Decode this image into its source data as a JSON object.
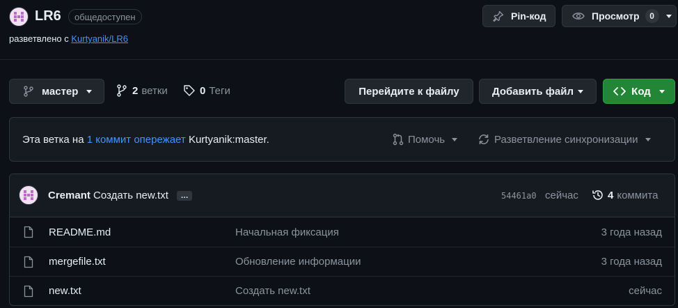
{
  "repo": {
    "name": "LR6",
    "visibility": "общедоступен",
    "forked_prefix": "разветвлено с",
    "forked_from": "Kurtyanik/LR6"
  },
  "actions": {
    "pin_label": "Pin-код",
    "watch_label": "Просмотр",
    "watch_count": "0"
  },
  "branch_bar": {
    "branch": "мастер",
    "branches_count": "2",
    "branches_label": "ветки",
    "tags_count": "0",
    "tags_label": "Теги",
    "goto_file": "Перейдите к файлу",
    "add_file": "Добавить файл",
    "code": "Код"
  },
  "ahead": {
    "prefix": "Эта ветка на",
    "link": "1 коммит опережает",
    "suffix": "Kurtyanik:master.",
    "contribute": "Помочь",
    "sync": "Разветвление синхронизации"
  },
  "latest_commit": {
    "author": "Cremant",
    "message": "Создать new.txt",
    "ellipsis": "…",
    "sha": "54461a0",
    "time": "сейчас",
    "commits_count": "4",
    "commits_label": "коммита"
  },
  "files": [
    {
      "name": "README.md",
      "message": "Начальная фиксация",
      "date": "3 года назад"
    },
    {
      "name": "mergefile.txt",
      "message": "Обновление информации",
      "date": "3 года назад"
    },
    {
      "name": "new.txt",
      "message": "Создать new.txt",
      "date": "сейчас"
    }
  ],
  "colors": {
    "background": "#0d1117",
    "link": "#4493f8",
    "code_button": "#238636"
  }
}
